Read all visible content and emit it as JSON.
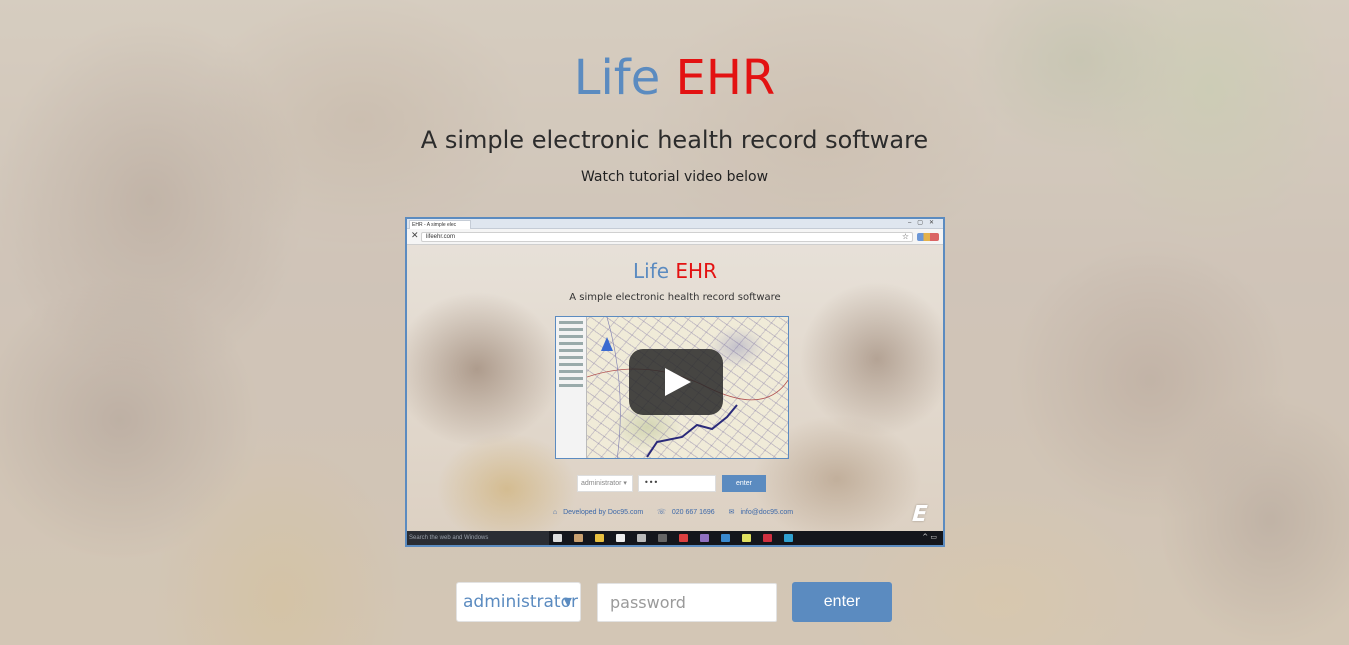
{
  "brand": {
    "part1": "Life",
    "part2": "EHR"
  },
  "tagline": "A simple electronic health record software",
  "subtitle": "Watch tutorial video below",
  "video": {
    "tab_title": "EHR - A simple elec",
    "url": "lifeehr.com",
    "brand_part1": "Life",
    "brand_part2": "EHR",
    "tagline": "A simple electronic health record software",
    "select_value": "administrator ▾",
    "password_mask": "•••",
    "button_label": "enter",
    "footer": {
      "developed": "Developed by Doc95.com",
      "phone": "020 667 1696",
      "email": "info@doc95.com"
    },
    "logo": "E",
    "taskbar_search": "Search the web and Windows"
  },
  "login": {
    "role_value": "administrator",
    "password_placeholder": "password",
    "enter_label": "enter"
  },
  "colors": {
    "accent": "#5b8bc0",
    "brand_red": "#e31212"
  }
}
